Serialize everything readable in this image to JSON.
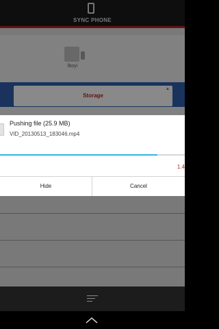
{
  "header": {
    "title": "SYNC PHONE"
  },
  "device": {
    "name": "lboyi"
  },
  "storage": {
    "label": "Storage"
  },
  "dialog": {
    "title": "Pushing file (25.9 MB)",
    "file_name": "VID_20130513_183046.mp4",
    "progress_fraction": 0.85,
    "speed_text": "1.4",
    "hide_label": "Hide",
    "cancel_label": "Cancel"
  },
  "colors": {
    "accent": "#b4202a",
    "progress": "#33b5e5",
    "header_bg": "#1b1b1b"
  }
}
